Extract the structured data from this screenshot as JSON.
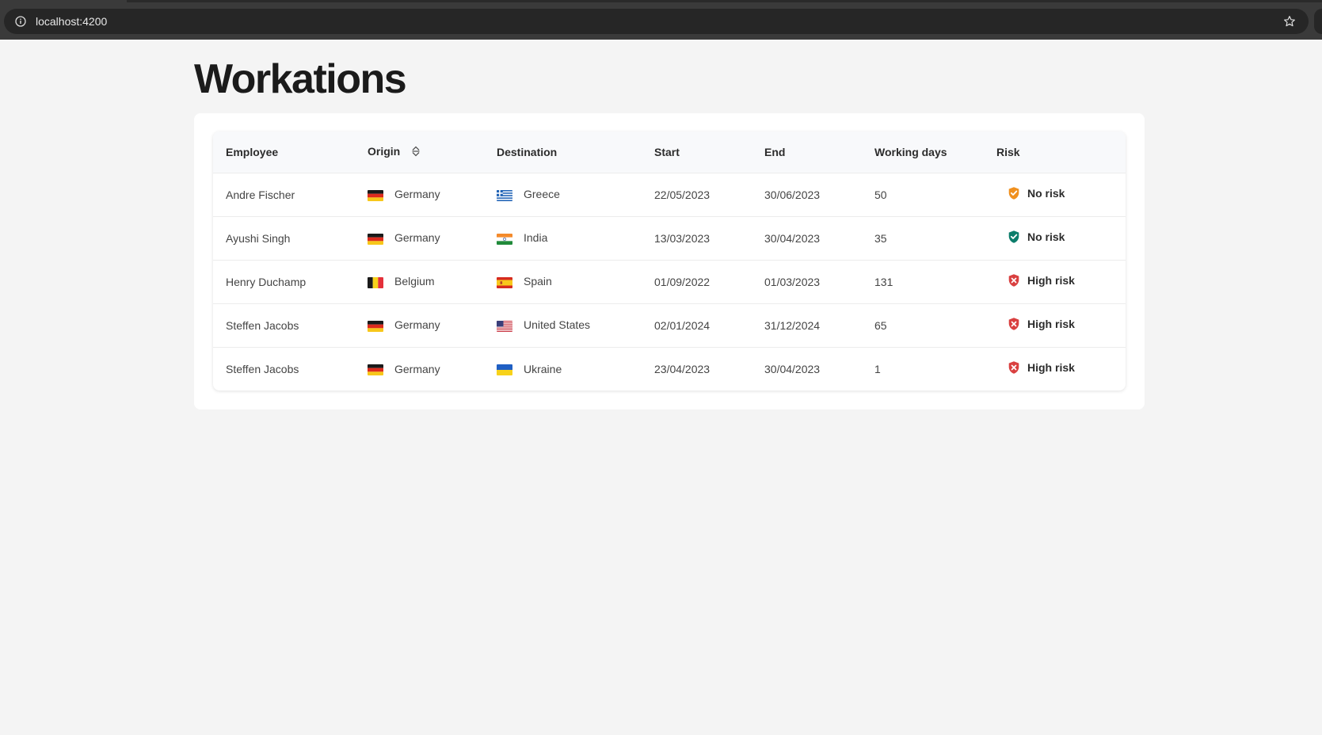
{
  "browser": {
    "url": "localhost:4200"
  },
  "page": {
    "title": "Workations"
  },
  "table": {
    "headers": {
      "employee": "Employee",
      "origin": "Origin",
      "destination": "Destination",
      "start": "Start",
      "end": "End",
      "working_days": "Working days",
      "risk": "Risk"
    },
    "rows": [
      {
        "employee": "Andre Fischer",
        "origin": "Germany",
        "origin_flag": "flag-germany-icon",
        "destination": "Greece",
        "destination_flag": "flag-greece-icon",
        "start": "22/05/2023",
        "end": "30/06/2023",
        "working_days": "50",
        "risk": "No risk",
        "risk_icon": "shield-check-icon",
        "risk_color": "#f0901e"
      },
      {
        "employee": "Ayushi Singh",
        "origin": "Germany",
        "origin_flag": "flag-germany-icon",
        "destination": "India",
        "destination_flag": "flag-india-icon",
        "start": "13/03/2023",
        "end": "30/04/2023",
        "working_days": "35",
        "risk": "No risk",
        "risk_icon": "shield-check-icon",
        "risk_color": "#0c7d6b"
      },
      {
        "employee": "Henry Duchamp",
        "origin": "Belgium",
        "origin_flag": "flag-belgium-icon",
        "destination": "Spain",
        "destination_flag": "flag-spain-icon",
        "start": "01/09/2022",
        "end": "01/03/2023",
        "working_days": "131",
        "risk": "High risk",
        "risk_icon": "shield-x-icon",
        "risk_color": "#d94040"
      },
      {
        "employee": "Steffen Jacobs",
        "origin": "Germany",
        "origin_flag": "flag-germany-icon",
        "destination": "United States",
        "destination_flag": "flag-united-states-icon",
        "start": "02/01/2024",
        "end": "31/12/2024",
        "working_days": "65",
        "risk": "High risk",
        "risk_icon": "shield-x-icon",
        "risk_color": "#d94040"
      },
      {
        "employee": "Steffen Jacobs",
        "origin": "Germany",
        "origin_flag": "flag-germany-icon",
        "destination": "Ukraine",
        "destination_flag": "flag-ukraine-icon",
        "start": "23/04/2023",
        "end": "30/04/2023",
        "working_days": "1",
        "risk": "High risk",
        "risk_icon": "shield-x-icon",
        "risk_color": "#d94040"
      }
    ]
  }
}
